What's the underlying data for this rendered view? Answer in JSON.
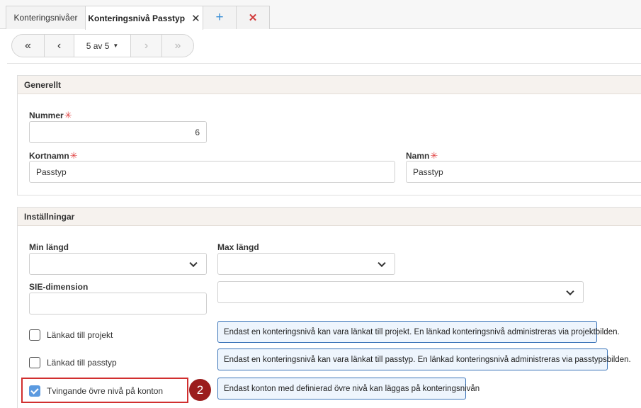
{
  "tabs": [
    {
      "label": "Konteringsnivåer",
      "active": false
    },
    {
      "label": "Konteringsnivå Passtyp",
      "active": true,
      "close": "✕"
    }
  ],
  "tab_actions": {
    "add": "+",
    "remove": "✕"
  },
  "pager": {
    "first": "«",
    "prev": "‹",
    "page": "5 av 5",
    "next": "›",
    "last": "»"
  },
  "general": {
    "title": "Generellt",
    "nummer": {
      "label": "Nummer",
      "required": "✳",
      "value": "6"
    },
    "kortnamn": {
      "label": "Kortnamn",
      "required": "✳",
      "value": "Passtyp"
    },
    "namn": {
      "label": "Namn",
      "required": "✳",
      "value": "Passtyp"
    }
  },
  "settings": {
    "title": "Inställningar",
    "min_length": {
      "label": "Min längd",
      "value": ""
    },
    "max_length": {
      "label": "Max längd",
      "value": ""
    },
    "sie_dimension": {
      "label": "SIE-dimension",
      "value": ""
    },
    "sie_select": {
      "value": ""
    },
    "checkboxes": [
      {
        "label": "Länkad till projekt",
        "checked": false,
        "info": "Endast en konteringsnivå kan vara länkat till projekt. En länkad konteringsnivå administreras via projektbilden."
      },
      {
        "label": "Länkad till passtyp",
        "checked": false,
        "info": "Endast en konteringsnivå kan vara länkat till passtyp. En länkad konteringsnivå administreras via passtypsbilden."
      },
      {
        "label": "Tvingande övre nivå på konton",
        "checked": true,
        "info": "Endast konton med definierad övre nivå kan läggas på konteringsnivån"
      }
    ]
  },
  "annotation": {
    "badge": "2",
    "color": "#d12f2f"
  },
  "colors": {
    "accent": "#3a8fd6",
    "danger": "#d23b3b",
    "info_border": "#3b74b8",
    "info_bg": "#eef5fd",
    "checkbox_checked": "#5b9ae0"
  }
}
